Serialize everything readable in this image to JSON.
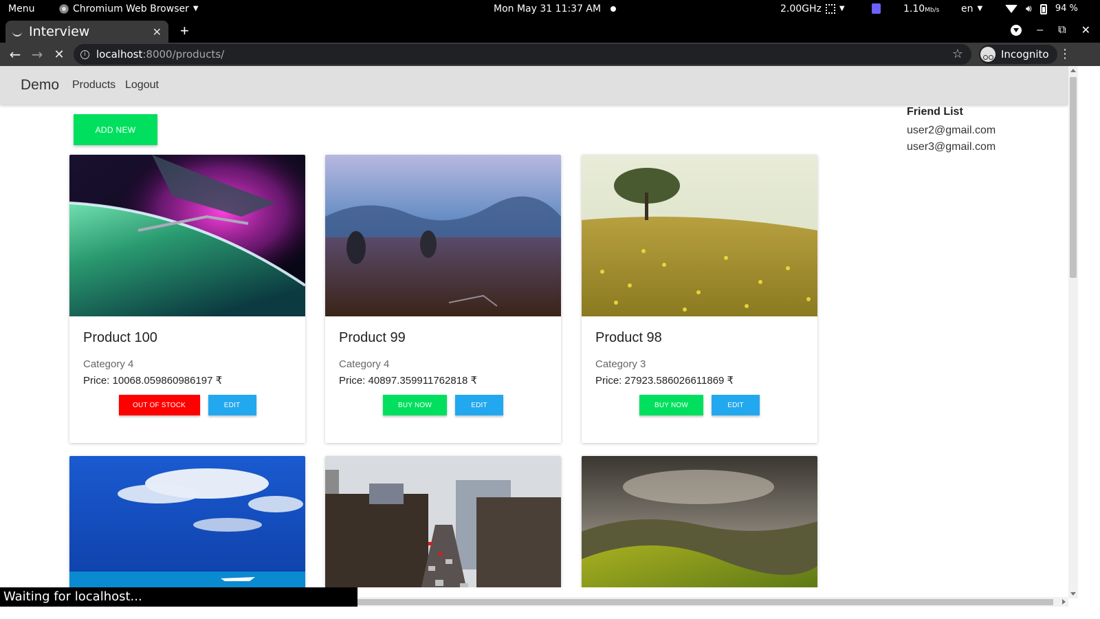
{
  "os": {
    "menu": "Menu",
    "browser_name": "Chromium Web Browser",
    "clock": "Mon May 31  11:37 AM",
    "cpu": "2.00GHz",
    "net_value": "1.10",
    "net_unit": "Mb/s",
    "lang": "en",
    "battery": "94 %"
  },
  "browser": {
    "tab_title": "Interview",
    "url_host": "localhost",
    "url_rest": ":8000/products/",
    "incognito_label": "Incognito",
    "status": "Waiting for localhost..."
  },
  "page": {
    "brand": "Demo",
    "nav": {
      "products": "Products",
      "logout": "Logout"
    },
    "add_new": "ADD NEW",
    "friends": {
      "title": "Friend List",
      "items": [
        "user2@gmail.com",
        "user3@gmail.com"
      ]
    },
    "products": [
      {
        "title": "Product 100",
        "category": "Category 4",
        "price": "Price: 10068.059860986197 ₹",
        "primary_label": "OUT OF STOCK",
        "edit_label": "EDIT"
      },
      {
        "title": "Product 99",
        "category": "Category 4",
        "price": "Price: 40897.359911762818 ₹",
        "primary_label": "BUY NOW",
        "edit_label": "EDIT"
      },
      {
        "title": "Product 98",
        "category": "Category 3",
        "price": "Price: 27923.586026611869 ₹",
        "primary_label": "BUY NOW",
        "edit_label": "EDIT"
      }
    ]
  },
  "colors": {
    "buy": "#00e05e",
    "out_of_stock": "#ff0000",
    "edit": "#22a8ee",
    "navbar": "#e0e0e0"
  }
}
